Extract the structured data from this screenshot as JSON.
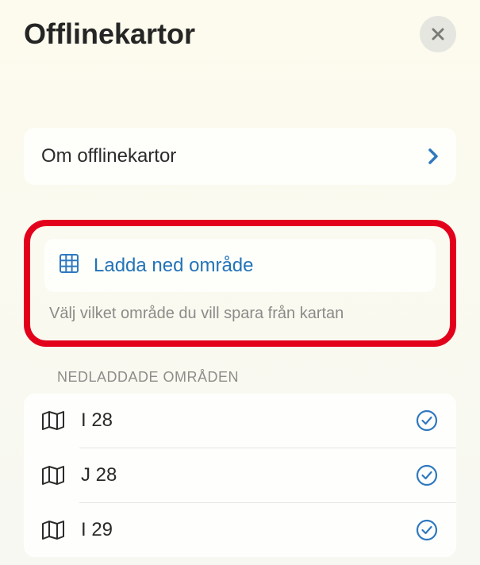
{
  "header": {
    "title": "Offlinekartor"
  },
  "about": {
    "label": "Om offlinekartor"
  },
  "download": {
    "label": "Ladda ned område",
    "hint": "Välj vilket område du vill spara från kartan"
  },
  "section": {
    "title": "NEDLADDADE OMRÅDEN"
  },
  "areas": [
    {
      "name": "I 28"
    },
    {
      "name": "J 28"
    },
    {
      "name": "I 29"
    }
  ]
}
